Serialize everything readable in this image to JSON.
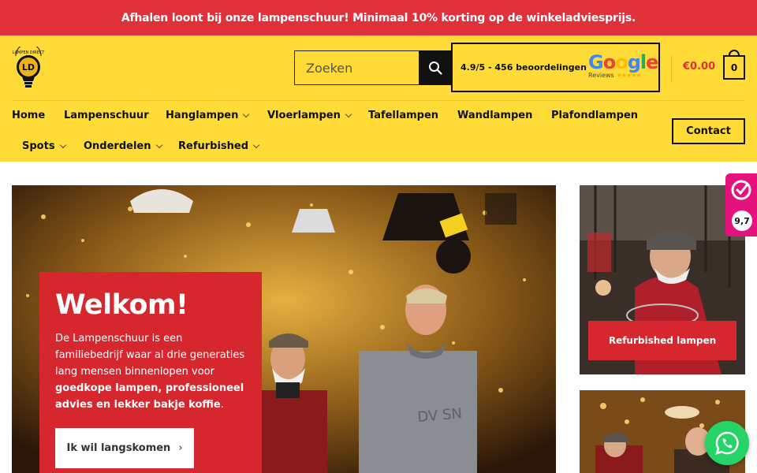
{
  "announcement": "Afhalen loont bij onze lampenschuur! Minimaal 10% korting op de winkeladviesprijs.",
  "header": {
    "logo_alt": "LD Lampen Direct",
    "search": {
      "placeholder": "Zoeken"
    },
    "reviews": {
      "text": "4.9/5 - 456 beoordelingen",
      "brand": "Google",
      "sub": "Reviews"
    },
    "cart": {
      "total": "€0.00",
      "count": "0"
    }
  },
  "nav": {
    "items": [
      {
        "label": "Home",
        "has_dropdown": false
      },
      {
        "label": "Lampenschuur",
        "has_dropdown": false
      },
      {
        "label": "Hanglampen",
        "has_dropdown": true
      },
      {
        "label": "Vloerlampen",
        "has_dropdown": true
      },
      {
        "label": "Tafellampen",
        "has_dropdown": false
      },
      {
        "label": "Wandlampen",
        "has_dropdown": false
      },
      {
        "label": "Plafondlampen",
        "has_dropdown": false
      },
      {
        "label": "Spots",
        "has_dropdown": true
      },
      {
        "label": "Onderdelen",
        "has_dropdown": true
      },
      {
        "label": "Refurbished",
        "has_dropdown": true
      }
    ],
    "contact_label": "Contact"
  },
  "hero": {
    "title": "Welkom!",
    "text_plain": "De Lampenschuur is een familiebedrijf waar al drie generaties lang mensen binnenlopen voor",
    "text_bold": "goedkope lampen, professioneel advies en lekker bakje koffie",
    "text_end": ".",
    "cta_label": "Ik wil langskomen",
    "cta_arrow": "›"
  },
  "side": {
    "refurbished_label": "Refurbished lampen"
  },
  "kiyoh": {
    "score": "9,7"
  },
  "colors": {
    "red": "#e0303a",
    "yellow": "#fedb37",
    "pink": "#e5127d",
    "whatsapp": "#25d366"
  }
}
